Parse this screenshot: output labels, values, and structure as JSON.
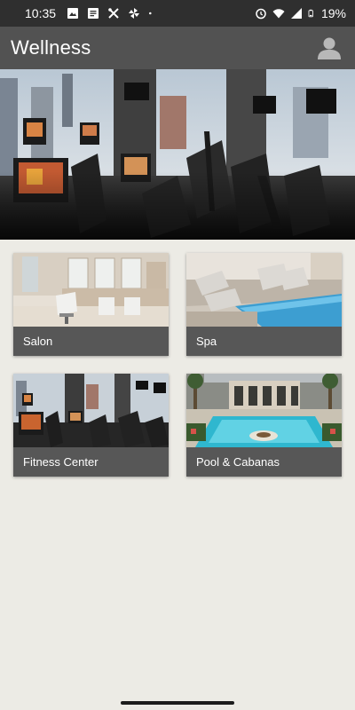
{
  "status_bar": {
    "time": "10:35",
    "battery": "19%",
    "left_icons": [
      "image-icon",
      "message-icon",
      "tools-icon",
      "pinwheel-icon",
      "dot-icon"
    ],
    "right_icons": [
      "alarm-icon",
      "wifi-icon",
      "signal-icon",
      "battery-icon"
    ]
  },
  "app_bar": {
    "title": "Wellness",
    "profile_icon": "account-icon"
  },
  "tiles": [
    {
      "label": "Salon",
      "image": "salon"
    },
    {
      "label": "Spa",
      "image": "spa"
    },
    {
      "label": "Fitness Center",
      "image": "fitness"
    },
    {
      "label": "Pool & Cabanas",
      "image": "pool"
    }
  ],
  "colors": {
    "status_bar": "#2f2f2f",
    "app_bar": "#525252",
    "background": "#ecebe5",
    "tile_label_bg": "#575757"
  }
}
